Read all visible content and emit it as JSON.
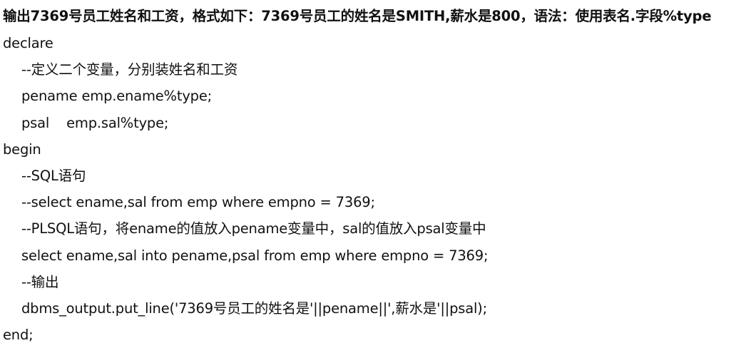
{
  "title": "输出7369号员工姓名和工资，格式如下：7369号员工的姓名是SMITH,薪水是800，语法：使用表名.字段%type",
  "lines": [
    {
      "indent": 0,
      "text": "declare"
    },
    {
      "indent": 1,
      "text": "--定义二个变量，分别装姓名和工资"
    },
    {
      "indent": 1,
      "text": "pename emp.ename%type;"
    },
    {
      "indent": 1,
      "text": "psal    emp.sal%type;"
    },
    {
      "indent": 0,
      "text": "begin"
    },
    {
      "indent": 1,
      "text": "--SQL语句"
    },
    {
      "indent": 1,
      "text": "--select ename,sal from emp where empno = 7369;"
    },
    {
      "indent": 1,
      "text": "--PLSQL语句，将ename的值放入pename变量中，sal的值放入psal变量中"
    },
    {
      "indent": 1,
      "text": "select ename,sal into pename,psal from emp where empno = 7369;"
    },
    {
      "indent": 1,
      "text": "--输出"
    },
    {
      "indent": 1,
      "text": "dbms_output.put_line('7369号员工的姓名是'||pename||',薪水是'||psal);"
    },
    {
      "indent": 0,
      "text": "end;"
    }
  ]
}
